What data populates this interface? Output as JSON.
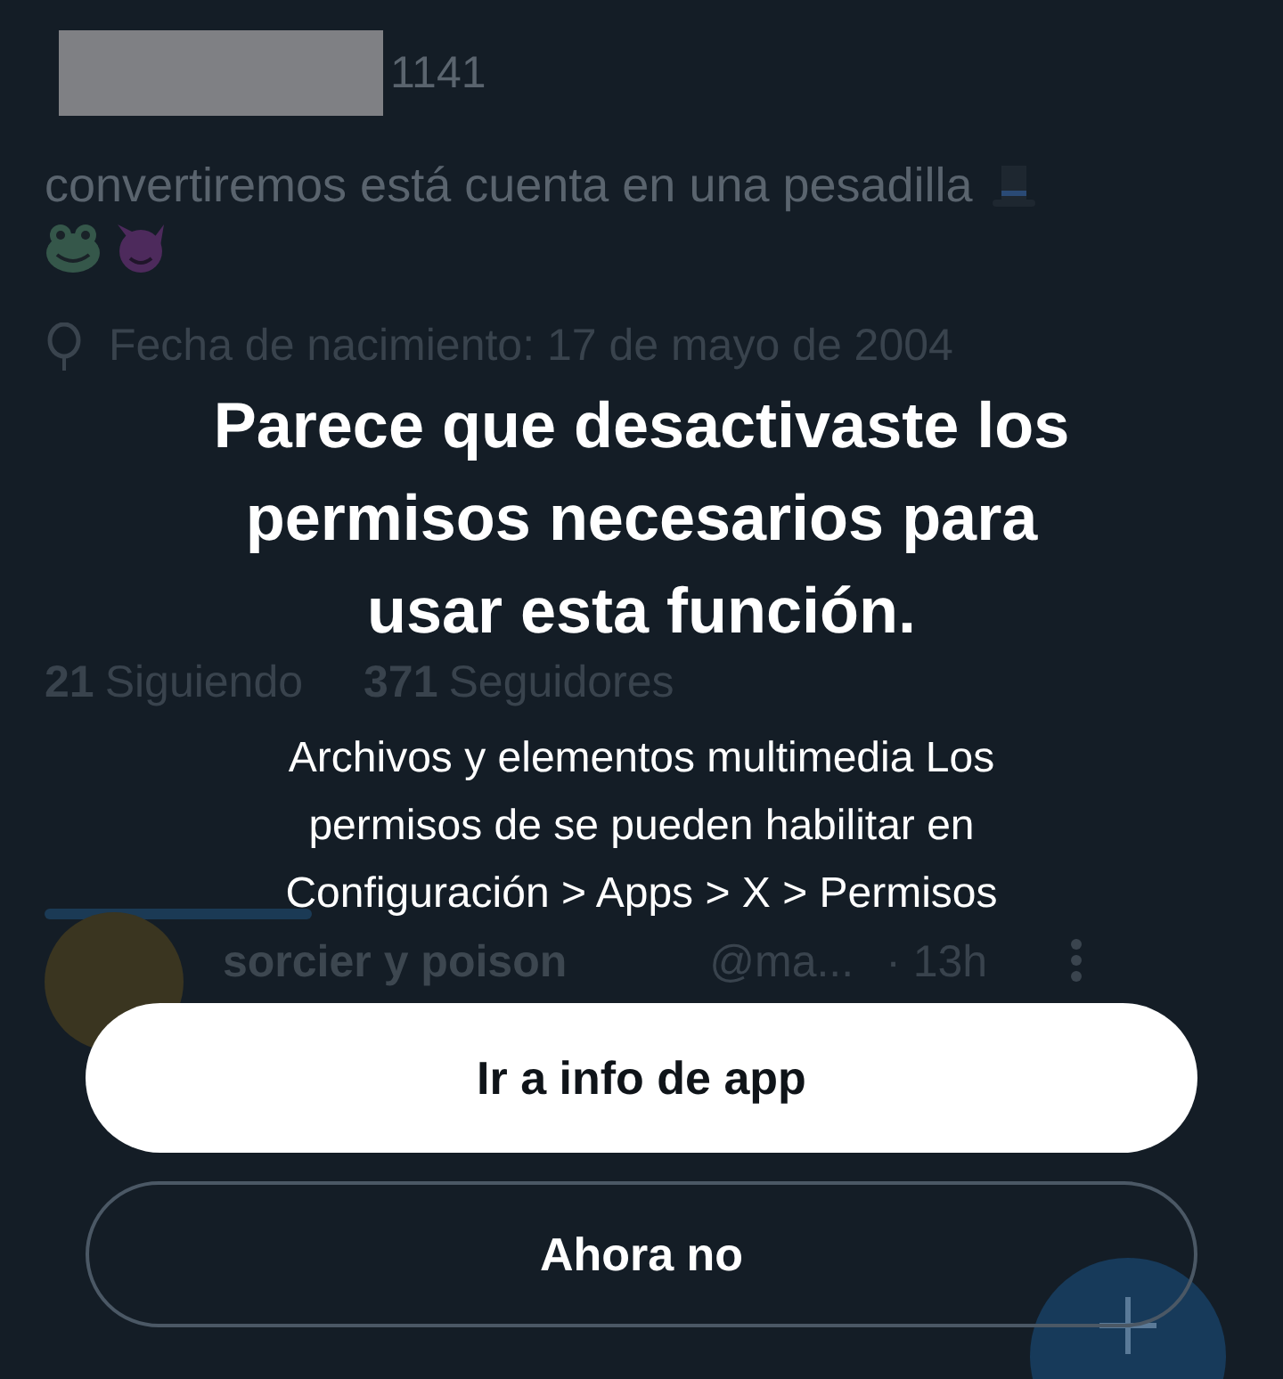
{
  "profile": {
    "handle_fragment": "1141",
    "bio": "convertiremos está cuenta en una pesadilla",
    "birth_date": "Fecha de nacimiento: 17 de mayo de 2004",
    "following_count": "21",
    "following_label": "Siguiendo",
    "followers_count": "371",
    "followers_label": "Seguidores"
  },
  "post": {
    "author": "sorcier y poison",
    "handle": "@ma...",
    "time": "· 13h"
  },
  "dialog": {
    "title": "Parece que desactivaste los permisos necesarios para usar esta función.",
    "message": "Archivos y elementos multimedia Los permisos de se pueden habilitar en Configuración > Apps > X > Permisos",
    "buttons": [
      {
        "label": "Ir a info de app",
        "kind": "primary"
      },
      {
        "label": "Ahora no",
        "kind": "secondary"
      }
    ]
  }
}
